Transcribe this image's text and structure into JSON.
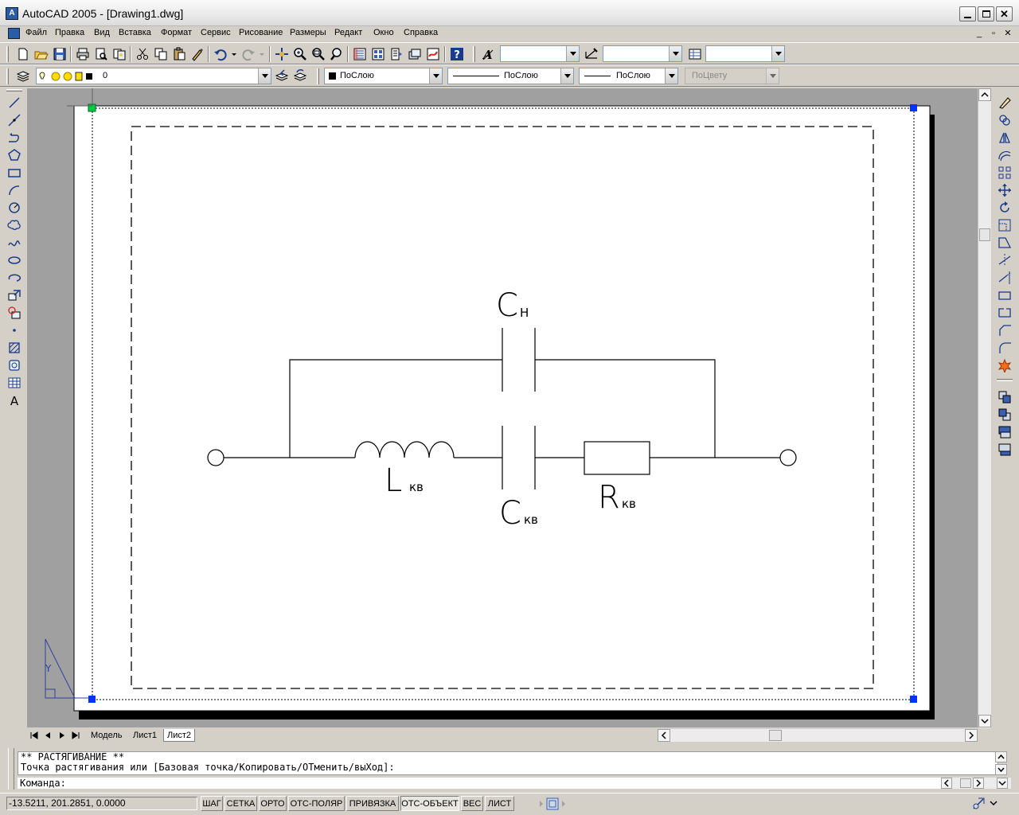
{
  "window": {
    "title": "AutoCAD 2005 - [Drawing1.dwg]",
    "app_icon": "autocad-icon"
  },
  "menu": {
    "items": [
      "Файл",
      "Правка",
      "Вид",
      "Вставка",
      "Формат",
      "Сервис",
      "Рисование",
      "Размеры",
      "Редакт",
      "Окно",
      "Справка"
    ]
  },
  "properties": {
    "layer": "0",
    "color": "ПоСлою",
    "linetype": "ПоСлою",
    "lineweight": "ПоСлою",
    "plotstyle": "ПоЦвету"
  },
  "layout_tabs": [
    "Модель",
    "Лист1",
    "Лист2"
  ],
  "active_tab": "Лист2",
  "drawing": {
    "labels": {
      "cn_main": "C",
      "cn_sub": "H",
      "lkv_main": "L",
      "lkv_sub": "кв",
      "ckv_main": "C",
      "ckv_sub": "кв",
      "rkv_main": "R",
      "rkv_sub": "кв"
    },
    "ucs_y": "Y"
  },
  "command": {
    "history_line1": "** РАСТЯГИВАНИЕ **",
    "history_line2": "Точка растягивания или [Базовая точка/Копировать/ОТменить/выХод]:",
    "prompt": "Команда:"
  },
  "status": {
    "coords": "-13.5211, 201.2851, 0.0000",
    "toggles": [
      "ШАГ",
      "СЕТКА",
      "ОРТО",
      "ОТС-ПОЛЯР",
      "ПРИВЯЗКА",
      "ОТС-ОБЪЕКТ",
      "ВЕС",
      "ЛИСТ"
    ],
    "active_toggle": "ОТС-ОБЪЕКТ"
  },
  "colors": {
    "grip": "#0033ff",
    "grip_hot": "#00cc44",
    "paper": "#ffffff",
    "background": "#a0a0a0"
  }
}
